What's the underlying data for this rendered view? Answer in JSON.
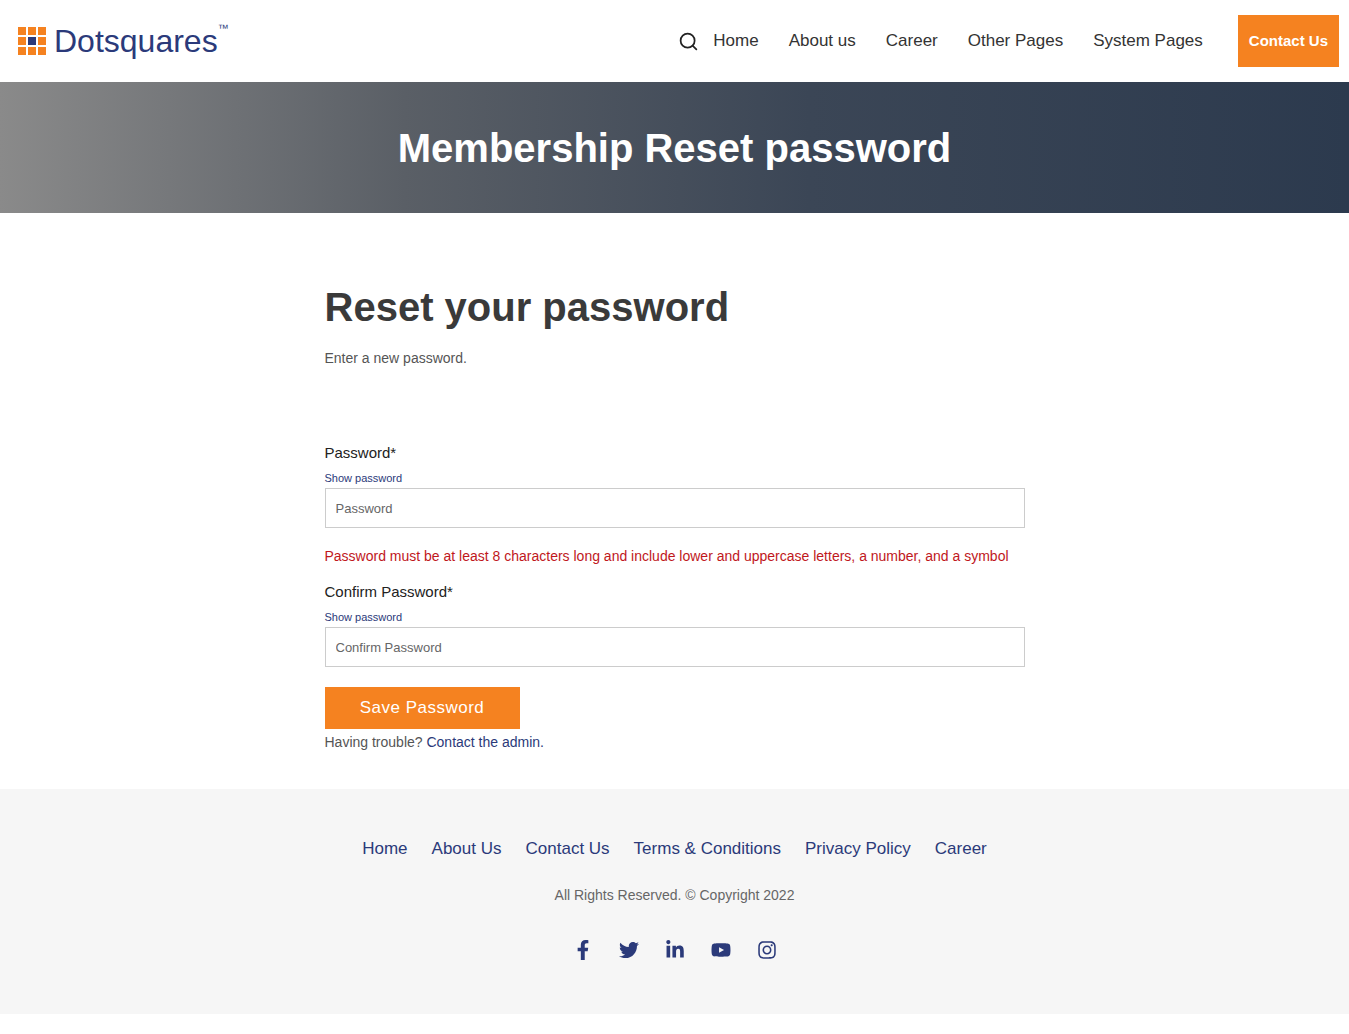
{
  "header": {
    "logo": {
      "text": "Dotsquares",
      "mark": "™"
    },
    "nav": [
      "Home",
      "About us",
      "Career",
      "Other Pages",
      "System Pages"
    ],
    "contact_button": "Contact Us"
  },
  "banner": {
    "title": "Membership Reset password"
  },
  "form": {
    "heading": "Reset your password",
    "subtitle": "Enter a new password.",
    "fields": [
      {
        "label": "Password",
        "required": "*",
        "toggle": "Show password",
        "placeholder": "Password",
        "error": "Password must be at least 8 characters long and include lower and uppercase letters, a number, and a symbol"
      },
      {
        "label": "Confirm Password",
        "required": "*",
        "toggle": "Show password",
        "placeholder": "Confirm Password",
        "error": ""
      }
    ],
    "submit": "Save Password",
    "help": {
      "text": "Having trouble?",
      "link": "Contact the admin."
    }
  },
  "footer": {
    "links": [
      "Home",
      "About Us",
      "Contact Us",
      "Terms & Conditions",
      "Privacy Policy",
      "Career"
    ],
    "copyright": "All Rights Reserved. © Copyright 2022"
  }
}
